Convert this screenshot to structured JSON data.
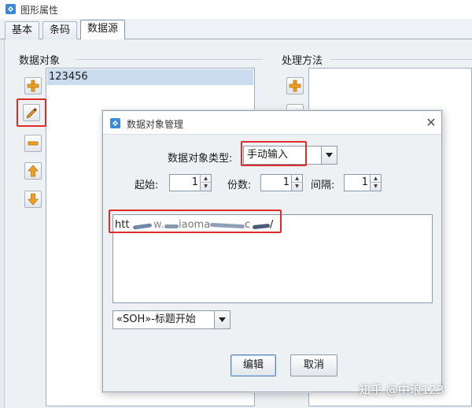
{
  "window": {
    "title": "图形属性",
    "tabs": [
      {
        "label": "基本"
      },
      {
        "label": "条码"
      },
      {
        "label": "数据源"
      }
    ],
    "active_tab": 2
  },
  "data_objects": {
    "group_label": "数据对象",
    "items": [
      "123456"
    ],
    "selected_index": 0,
    "tools": [
      {
        "name": "add",
        "icon": "plus-icon"
      },
      {
        "name": "edit",
        "icon": "pencil-icon",
        "highlighted": true
      },
      {
        "name": "remove",
        "icon": "minus-icon"
      },
      {
        "name": "move-up",
        "icon": "arrow-up-icon"
      },
      {
        "name": "move-down",
        "icon": "arrow-down-icon"
      }
    ]
  },
  "processing": {
    "group_label": "处理方法"
  },
  "dialog": {
    "title": "数据对象管理",
    "type_label": "数据对象类型:",
    "type_value": "手动输入",
    "start_label": "起始:",
    "start_value": "1",
    "copies_label": "份数:",
    "copies_value": "1",
    "interval_label": "间隔:",
    "interval_value": "1",
    "text_prefix": "htt",
    "text_mid": "w.",
    "text_mid2": "iaoma",
    "text_mid3": "c",
    "text_suffix": "/",
    "control_char": "«SOH»-标题开始",
    "edit_button": "编辑",
    "cancel_button": "取消"
  },
  "watermark": "知乎 @中琅123",
  "colors": {
    "highlight": "#e02b2b",
    "selection": "#cbdcf1",
    "icon_orange": "#f0a020",
    "scribble": "#5c6f8c"
  }
}
